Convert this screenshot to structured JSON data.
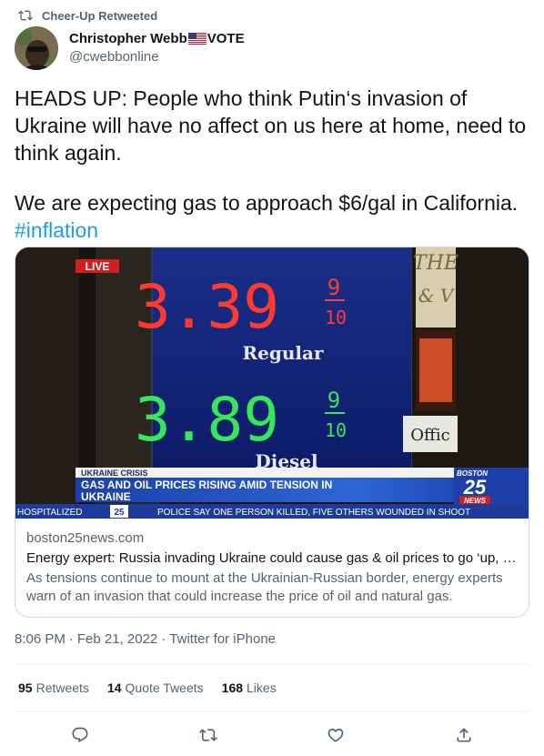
{
  "retweet_header": {
    "label": "Cheer-Up Retweeted",
    "icon": "retweet-icon"
  },
  "author": {
    "name": "Christopher Webb",
    "name_suffix": "VOTE",
    "flag_icon": "us-flag-icon",
    "handle": "@cwebbonline"
  },
  "tweet": {
    "lines": [
      "HEADS UP: People who think Putin‘s invasion of",
      "Ukraine will have no affect on us here at home, need to",
      "think again.",
      "We are expecting gas to approach $6/gal in California."
    ],
    "hashtag": "#inflation"
  },
  "card": {
    "media": {
      "live_badge": "LIVE",
      "price_regular": "3.39",
      "price_regular_frac_top": "9",
      "price_regular_frac_bottom": "10",
      "regular_label": "Regular",
      "price_diesel": "3.89",
      "price_diesel_frac_top": "9",
      "price_diesel_frac_bottom": "10",
      "diesel_label": "Diesel",
      "chyron_tag": "UKRAINE CRISIS",
      "chyron_headline_1": "GAS AND OIL PRICES RISING AMID TENSION IN",
      "chyron_headline_2": "UKRAINE",
      "station_top": "BOSTON",
      "station_num": "25",
      "station_bottom": "NEWS",
      "ticker_left": "HOSPITALIZED",
      "ticker_logo": "25",
      "ticker_text": "POLICE SAY ONE PERSON KILLED, FIVE OTHERS WOUNDED IN SHOOT",
      "sign_fragment_1": "THE",
      "sign_fragment_2": "& V",
      "sign_fragment_3": "Offic"
    },
    "domain": "boston25news.com",
    "title": "Energy expert: Russia invading Ukraine could cause gas & oil prices to go ‘up, u...",
    "description": "As tensions continue to mount at the Ukrainian-Russian border, energy experts warn of an invasion that could increase the price of oil and natural gas."
  },
  "meta": {
    "time": "8:06 PM",
    "separator": "·",
    "date": "Feb 21, 2022",
    "source": "Twitter for iPhone"
  },
  "stats": {
    "retweets_count": "95",
    "retweets_label": "Retweets",
    "quotes_count": "14",
    "quotes_label": "Quote Tweets",
    "likes_count": "168",
    "likes_label": "Likes"
  },
  "actions": [
    "reply-icon",
    "retweet-icon",
    "like-icon",
    "share-icon"
  ],
  "colors": {
    "link": "#1d9bf0",
    "secondary_text": "#536471",
    "border": "#cfd9de",
    "divider": "#eff3f4",
    "price_red": "#ff3b2f",
    "price_green": "#37e65a"
  }
}
